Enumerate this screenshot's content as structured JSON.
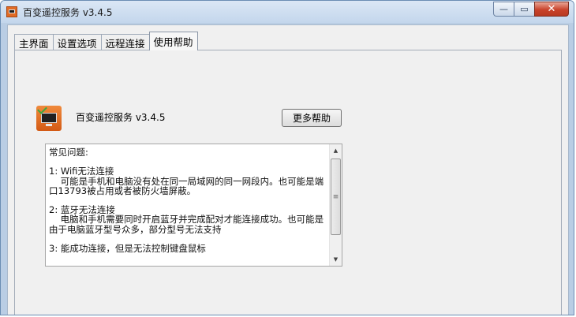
{
  "window": {
    "title": "百变遥控服务 v3.4.5",
    "min_glyph": "—",
    "max_glyph": "▭",
    "close_glyph": "✕"
  },
  "tabs": [
    {
      "label": "主界面",
      "active": false
    },
    {
      "label": "设置选项",
      "active": false
    },
    {
      "label": "远程连接",
      "active": false
    },
    {
      "label": "使用帮助",
      "active": true
    }
  ],
  "help_panel": {
    "app_name": "百变遥控服务 v3.4.5",
    "more_help_button": "更多帮助",
    "faq_text": "常见问题:\n\n1: Wifi无法连接\n    可能是手机和电脑没有处在同一局域网的同一网段内。也可能是端口13793被占用或者被防火墙屏蔽。\n\n2: 蓝牙无法连接\n    电脑和手机需要同时开启蓝牙并完成配对才能连接成功。也可能是由于电脑蓝牙型号众多，部分型号无法支持\n\n3: 能成功连接，但是无法控制键盘鼠标"
  },
  "icons": {
    "app": "app-monitor-icon",
    "scroll_up": "▲",
    "scroll_down": "▼",
    "thumb_grip": "≡"
  },
  "colors": {
    "title_bar": "#c3d6ec",
    "close_button": "#c9432b",
    "panel_bg": "#f0f0f0"
  }
}
